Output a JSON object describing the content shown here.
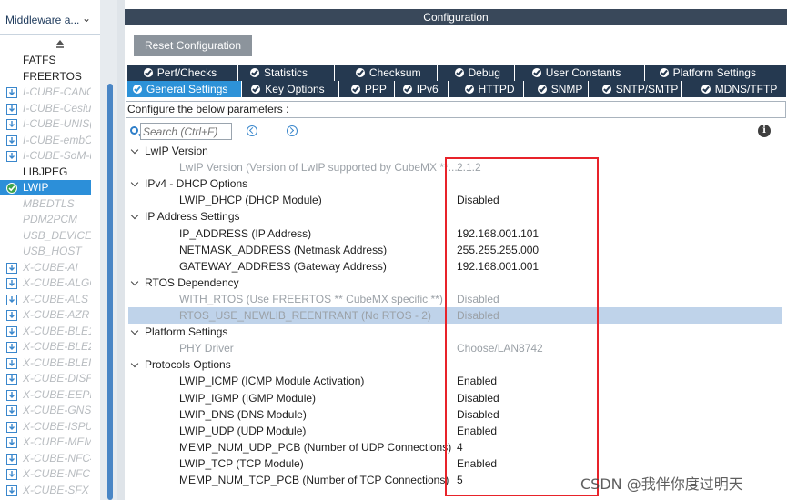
{
  "sidebar": {
    "category_label": "Middleware a...",
    "items": [
      {
        "label": "FATFS",
        "style": "plain"
      },
      {
        "label": "FREERTOS",
        "style": "plain"
      },
      {
        "label": "I-CUBE-CANC",
        "style": "pack"
      },
      {
        "label": "I-CUBE-Cesiu",
        "style": "pack"
      },
      {
        "label": "I-CUBE-UNIS(",
        "style": "pack"
      },
      {
        "label": "I-CUBE-embC",
        "style": "pack"
      },
      {
        "label": "I-CUBE-SoM-u",
        "style": "pack"
      },
      {
        "label": "LIBJPEG",
        "style": "plain"
      },
      {
        "label": "LWIP",
        "style": "selected"
      },
      {
        "label": "MBEDTLS",
        "style": "italic"
      },
      {
        "label": "PDM2PCM",
        "style": "italic"
      },
      {
        "label": "USB_DEVICE",
        "style": "italic"
      },
      {
        "label": "USB_HOST",
        "style": "italic"
      },
      {
        "label": "X-CUBE-AI",
        "style": "pack"
      },
      {
        "label": "X-CUBE-ALGC",
        "style": "pack"
      },
      {
        "label": "X-CUBE-ALS",
        "style": "pack"
      },
      {
        "label": "X-CUBE-AZR",
        "style": "pack"
      },
      {
        "label": "X-CUBE-BLE1",
        "style": "pack"
      },
      {
        "label": "X-CUBE-BLE2",
        "style": "pack"
      },
      {
        "label": "X-CUBE-BLEI",
        "style": "pack"
      },
      {
        "label": "X-CUBE-DISF",
        "style": "pack"
      },
      {
        "label": "X-CUBE-EEPI",
        "style": "pack"
      },
      {
        "label": "X-CUBE-GNS",
        "style": "pack"
      },
      {
        "label": "X-CUBE-ISPU",
        "style": "pack"
      },
      {
        "label": "X-CUBE-MEM",
        "style": "pack"
      },
      {
        "label": "X-CUBE-NFC4",
        "style": "pack"
      },
      {
        "label": "X-CUBE-NFC7",
        "style": "pack"
      },
      {
        "label": "X-CUBE-SFX",
        "style": "pack"
      },
      {
        "label": "X-CUBE-SUB",
        "style": "pack"
      }
    ]
  },
  "config": {
    "header": "Configuration",
    "reset_button": "Reset Configuration",
    "tabs_row1": [
      "Perf/Checks",
      "Statistics",
      "Checksum",
      "Debug",
      "User Constants",
      "Platform Settings"
    ],
    "tabs_row2": [
      "General Settings",
      "Key Options",
      "PPP",
      "IPv6",
      "HTTPD",
      "SNMP",
      "SNTP/SMTP",
      "MDNS/TFTP"
    ],
    "active_tab": "General Settings",
    "configure_label": "Configure the below parameters :",
    "search_placeholder": "Search (Ctrl+F)"
  },
  "tree": [
    {
      "group": "LwIP Version",
      "params": [
        {
          "name": "LwIP Version (Version of LwIP supported by CubeMX **...",
          "value": "2.1.2",
          "dim": true
        }
      ]
    },
    {
      "group": "IPv4 - DHCP Options",
      "params": [
        {
          "name": "LWIP_DHCP (DHCP Module)",
          "value": "Disabled"
        }
      ]
    },
    {
      "group": "IP Address Settings",
      "params": [
        {
          "name": "IP_ADDRESS (IP Address)",
          "value": "192.168.001.101"
        },
        {
          "name": "NETMASK_ADDRESS (Netmask Address)",
          "value": "255.255.255.000"
        },
        {
          "name": "GATEWAY_ADDRESS (Gateway Address)",
          "value": "192.168.001.001"
        }
      ]
    },
    {
      "group": "RTOS Dependency",
      "params": [
        {
          "name": "WITH_RTOS (Use FREERTOS ** CubeMX specific **)",
          "value": "Disabled",
          "dim": true
        },
        {
          "name": "RTOS_USE_NEWLIB_REENTRANT (No RTOS - 2)",
          "value": "Disabled",
          "dim": true,
          "highlight": true
        }
      ]
    },
    {
      "group": "Platform Settings",
      "params": [
        {
          "name": "PHY Driver",
          "value": "Choose/LAN8742",
          "dim": true
        }
      ]
    },
    {
      "group": "Protocols Options",
      "params": [
        {
          "name": "LWIP_ICMP (ICMP Module Activation)",
          "value": "Enabled"
        },
        {
          "name": "LWIP_IGMP (IGMP Module)",
          "value": "Disabled"
        },
        {
          "name": "LWIP_DNS (DNS Module)",
          "value": "Disabled"
        },
        {
          "name": "LWIP_UDP (UDP Module)",
          "value": "Enabled"
        },
        {
          "name": "MEMP_NUM_UDP_PCB (Number of UDP Connections)",
          "value": "4"
        },
        {
          "name": "LWIP_TCP (TCP Module)",
          "value": "Enabled"
        },
        {
          "name": "MEMP_NUM_TCP_PCB (Number of TCP Connections)",
          "value": "5"
        }
      ]
    }
  ],
  "watermark": "CSDN @我伴你度过明天",
  "colors": {
    "header_bg": "#39485a",
    "tab_bg": "#253950",
    "tab_active_bg": "#2d92d8",
    "selected_item_bg": "#2c8fd9",
    "highlight_row_bg": "#bfd3ea",
    "annotation_box": "#e8232a"
  }
}
